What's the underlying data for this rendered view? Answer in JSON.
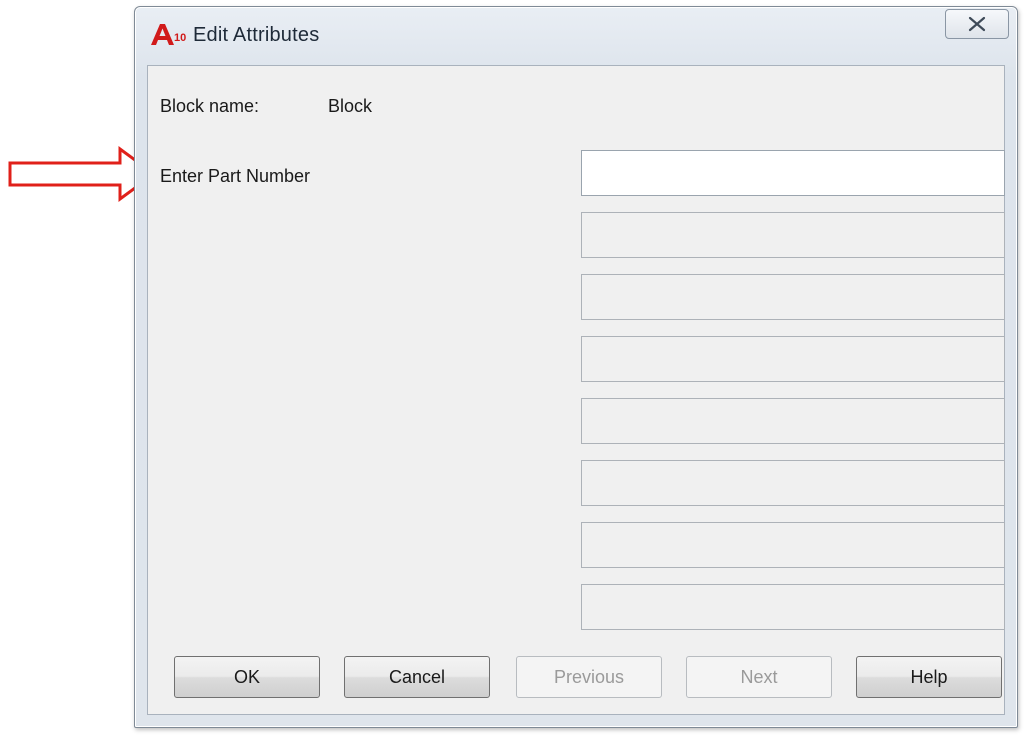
{
  "window": {
    "title": "Edit Attributes",
    "app_icon": "autocad-app-icon",
    "close_icon": "close-icon"
  },
  "block": {
    "label": "Block name:",
    "value": "Block"
  },
  "prompts": [
    {
      "label": "Enter Part Number",
      "value": ""
    }
  ],
  "buttons": {
    "ok": "OK",
    "cancel": "Cancel",
    "previous": "Previous",
    "next": "Next",
    "help": "Help"
  },
  "colors": {
    "annotation_arrow": "#e0201a",
    "dialog_frame": "#dfe5ec",
    "client_bg": "#f0f0f0"
  }
}
